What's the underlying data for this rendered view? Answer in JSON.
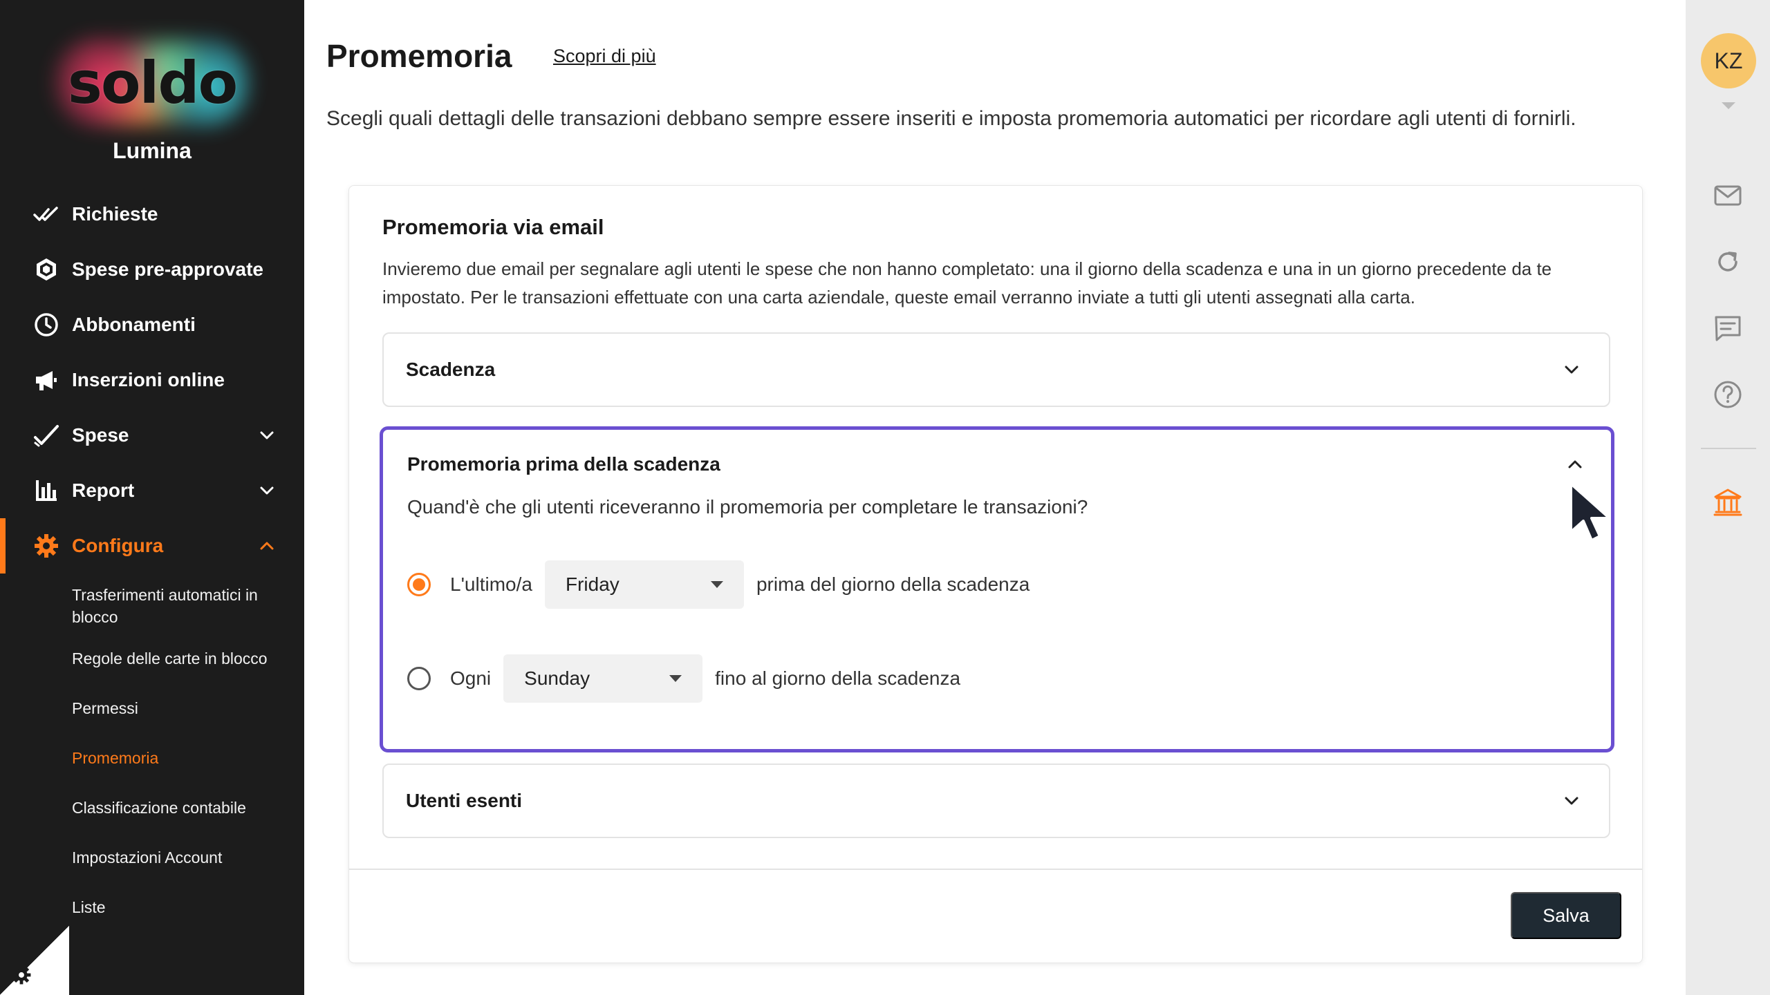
{
  "sidebar": {
    "brand": "soldo",
    "company": "Lumina",
    "items": [
      {
        "label": "Richieste",
        "icon": "double-check-icon"
      },
      {
        "label": "Spese pre-approvate",
        "icon": "hexagon-icon"
      },
      {
        "label": "Abbonamenti",
        "icon": "clock-icon"
      },
      {
        "label": "Inserzioni online",
        "icon": "megaphone-icon"
      },
      {
        "label": "Spese",
        "icon": "check-icon",
        "expandable": true
      },
      {
        "label": "Report",
        "icon": "bar-chart-icon",
        "expandable": true
      },
      {
        "label": "Configura",
        "icon": "gear-icon",
        "expandable": true,
        "expanded": true,
        "active": true
      }
    ],
    "subitems": [
      {
        "label": "Trasferimenti automatici in blocco"
      },
      {
        "label": "Regole delle carte in blocco"
      },
      {
        "label": "Permessi"
      },
      {
        "label": "Promemoria",
        "active": true
      },
      {
        "label": "Classificazione contabile"
      },
      {
        "label": "Impostazioni Account"
      },
      {
        "label": "Liste"
      }
    ]
  },
  "header": {
    "title": "Promemoria",
    "learn_more": "Scopri di più",
    "description": "Scegli quali dettagli delle transazioni debbano sempre essere inseriti e imposta promemoria automatici per ricordare agli utenti di fornirli."
  },
  "card": {
    "title": "Promemoria via email",
    "description": "Invieremo due email per segnalare agli utenti le spese che non hanno completato: una il giorno della scadenza e una in un giorno precedente da te impostato. Per le transazioni effettuate con una carta aziendale, queste email verranno inviate a tutti gli utenti assegnati alla carta.",
    "sections": {
      "deadline": {
        "title": "Scadenza"
      },
      "reminder": {
        "title": "Promemoria prima della scadenza",
        "question": "Quand'è che gli utenti riceveranno il promemoria per completare le transazioni?",
        "option1": {
          "label": "L'ultimo/a",
          "select": "Friday",
          "suffix": "prima del giorno della scadenza",
          "checked": true
        },
        "option2": {
          "label": "Ogni",
          "select": "Sunday",
          "suffix": "fino al giorno della scadenza",
          "checked": false
        }
      },
      "exempt": {
        "title": "Utenti esenti"
      }
    },
    "save_label": "Salva"
  },
  "rail": {
    "avatar_initials": "KZ",
    "icons": [
      "mail-icon",
      "refresh-icon",
      "chat-icon",
      "help-icon",
      "bank-icon"
    ]
  },
  "colors": {
    "accent": "#ff7a1a",
    "focus_border": "#6a4fd1",
    "sidebar_bg": "#1c1c1c",
    "save_bg": "#1f2a33",
    "avatar_bg": "#f7c66b"
  }
}
